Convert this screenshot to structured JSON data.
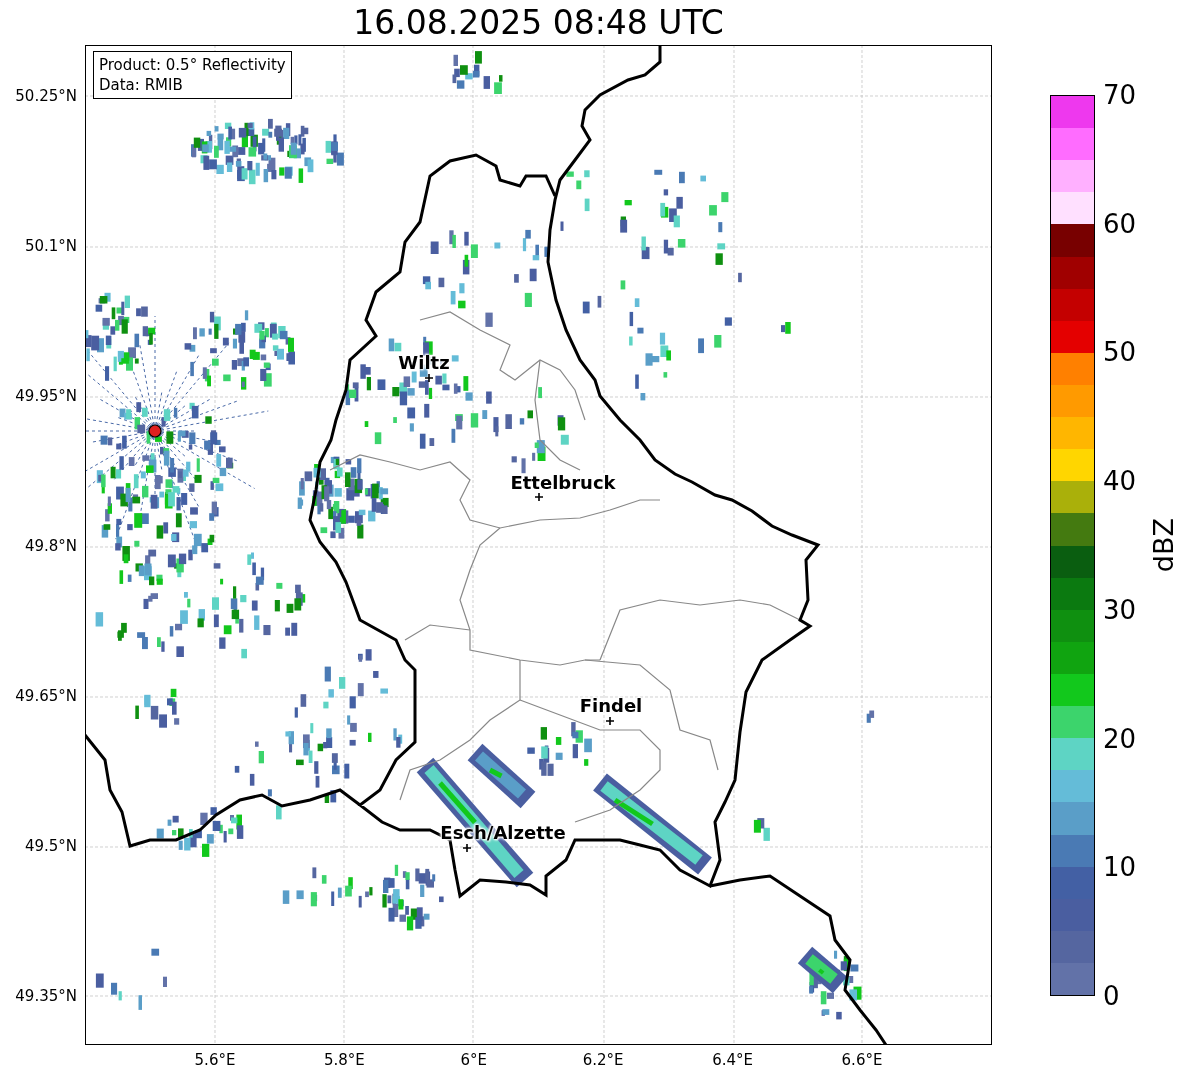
{
  "title": "16.08.2025 08:48 UTC",
  "legend": {
    "lines": [
      "Product: 0.5° Reflectivity",
      "Data: RMIB"
    ]
  },
  "cities": [
    {
      "name": "Wiltz"
    },
    {
      "name": "Ettelbruck"
    },
    {
      "name": "Findel"
    },
    {
      "name": "Esch/Alzette"
    }
  ],
  "axes": {
    "yticks": [
      "50.25°N",
      "50.1°N",
      "49.95°N",
      "49.8°N",
      "49.65°N",
      "49.5°N",
      "49.35°N"
    ],
    "xticks": [
      "5.6°E",
      "5.8°E",
      "6°E",
      "6.2°E",
      "6.4°E",
      "6.6°E"
    ]
  },
  "colorbar": {
    "label": "dBZ",
    "ticks": [
      "70",
      "60",
      "50",
      "40",
      "30",
      "20",
      "10",
      "0"
    ],
    "bands": [
      {
        "color": "#ee38ee"
      },
      {
        "color": "#ff6cff"
      },
      {
        "color": "#ffb0ff"
      },
      {
        "color": "#ffe0ff"
      },
      {
        "color": "#780000"
      },
      {
        "color": "#a00000"
      },
      {
        "color": "#c40000"
      },
      {
        "color": "#e40000"
      },
      {
        "color": "#ff8000"
      },
      {
        "color": "#ff9a00"
      },
      {
        "color": "#ffb600"
      },
      {
        "color": "#ffd600"
      },
      {
        "color": "#aab00a"
      },
      {
        "color": "#447a10"
      },
      {
        "color": "#0a5e10"
      },
      {
        "color": "#0b7a10"
      },
      {
        "color": "#0f9010"
      },
      {
        "color": "#10a410"
      },
      {
        "color": "#12c81c"
      },
      {
        "color": "#3cd46c"
      },
      {
        "color": "#5ed4c4"
      },
      {
        "color": "#64bcd8"
      },
      {
        "color": "#5a9ec8"
      },
      {
        "color": "#4a7ab4"
      },
      {
        "color": "#4360a4"
      },
      {
        "color": "#4a5ea0"
      },
      {
        "color": "#5566a0"
      },
      {
        "color": "#6272a8"
      }
    ]
  }
}
